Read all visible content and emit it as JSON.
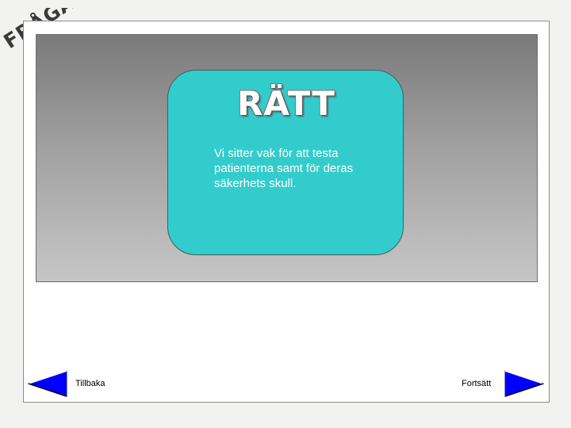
{
  "corner_label": "FRÅGA",
  "answer": {
    "title": "RÄTT",
    "explanation": "Vi sitter vak för att testa patienterna samt för deras säkerhets skull."
  },
  "navigation": {
    "back_label": "Tillbaka",
    "next_label": "Fortsätt"
  },
  "colors": {
    "card": "#33cccc",
    "arrow_fill": "#0000ff",
    "corner_label": "#3a3a3a"
  },
  "icons": {
    "back": "arrow-left-icon",
    "next": "arrow-right-icon"
  }
}
